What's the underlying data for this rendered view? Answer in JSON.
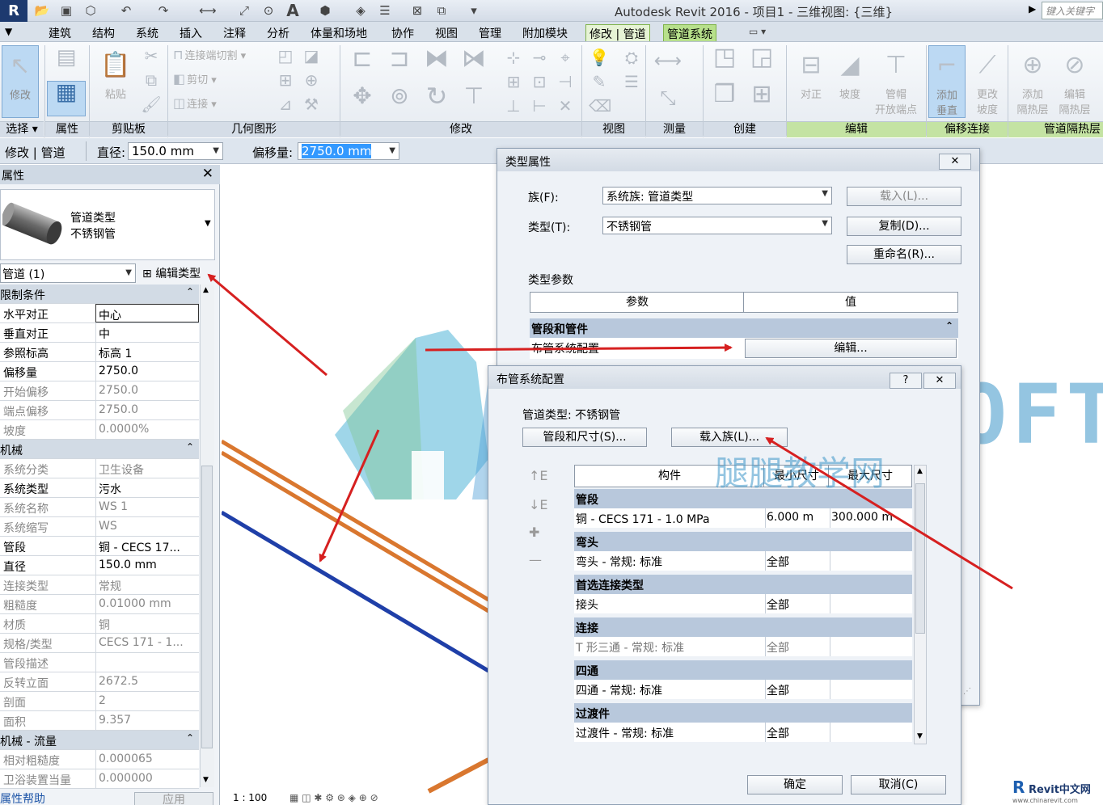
{
  "titlebar": {
    "app_letter": "R",
    "title": "Autodesk Revit 2016 -    项目1 - 三维视图: {三维}",
    "search_placeholder": "键入关键字"
  },
  "tabs": [
    "建筑",
    "结构",
    "系统",
    "插入",
    "注释",
    "分析",
    "体量和场地",
    "协作",
    "视图",
    "管理",
    "附加模块",
    "修改 | 管道",
    "管道系统"
  ],
  "ribbon": {
    "groups": [
      "选择",
      "属性",
      "剪贴板",
      "几何图形",
      "修改",
      "视图",
      "测量",
      "创建",
      "编辑",
      "偏移连接",
      "管道隔热层"
    ],
    "buttons": {
      "modify": "修改",
      "paste": "粘贴",
      "join_cutback": "连接端切割",
      "cut": "剪切",
      "join": "连接",
      "justify": "对正",
      "slope": "坡度",
      "pipe_cap_1": "管帽",
      "pipe_cap_2": "开放端点",
      "add_vertical_1": "添加",
      "add_vertical_2": "垂直",
      "change_slope_1": "更改",
      "change_slope_2": "坡度",
      "add_insulation_1": "添加",
      "add_insulation_2": "隔热层",
      "edit_insulation_1": "编辑",
      "edit_insulation_2": "隔热层"
    }
  },
  "options_bar": {
    "context": "修改 | 管道",
    "diameter_label": "直径:",
    "diameter_value": "150.0 mm",
    "offset_label": "偏移量:",
    "offset_value": "2750.0 mm"
  },
  "properties": {
    "title": "属性",
    "type_line1": "管道类型",
    "type_line2": "不锈钢管",
    "filter": "管道 (1)",
    "edit_type": "编辑类型",
    "help": "属性帮助",
    "apply": "应用",
    "rows": [
      {
        "name": "限制条件",
        "value": "",
        "kind": "hdr"
      },
      {
        "name": "水平对正",
        "value": "中心",
        "kind": "focus"
      },
      {
        "name": "垂直对正",
        "value": "中",
        "kind": ""
      },
      {
        "name": "参照标高",
        "value": "标高 1",
        "kind": ""
      },
      {
        "name": "偏移量",
        "value": "2750.0",
        "kind": ""
      },
      {
        "name": "开始偏移",
        "value": "2750.0",
        "kind": "dis"
      },
      {
        "name": "端点偏移",
        "value": "2750.0",
        "kind": "dis"
      },
      {
        "name": "坡度",
        "value": "0.0000%",
        "kind": "dis"
      },
      {
        "name": "机械",
        "value": "",
        "kind": "hdr"
      },
      {
        "name": "系统分类",
        "value": "卫生设备",
        "kind": "dis"
      },
      {
        "name": "系统类型",
        "value": "污水",
        "kind": ""
      },
      {
        "name": "系统名称",
        "value": "WS 1",
        "kind": "dis"
      },
      {
        "name": "系统缩写",
        "value": "WS",
        "kind": "dis"
      },
      {
        "name": "管段",
        "value": "铜 - CECS 17...",
        "kind": ""
      },
      {
        "name": "直径",
        "value": "150.0 mm",
        "kind": ""
      },
      {
        "name": "连接类型",
        "value": "常规",
        "kind": "dis"
      },
      {
        "name": "粗糙度",
        "value": "0.01000 mm",
        "kind": "dis"
      },
      {
        "name": "材质",
        "value": "铜",
        "kind": "dis"
      },
      {
        "name": "规格/类型",
        "value": "CECS 171 - 1...",
        "kind": "dis"
      },
      {
        "name": "管段描述",
        "value": "",
        "kind": "dis"
      },
      {
        "name": "反转立面",
        "value": "2672.5",
        "kind": "dis"
      },
      {
        "name": "剖面",
        "value": "2",
        "kind": "dis"
      },
      {
        "name": "面积",
        "value": "9.357",
        "kind": "dis"
      },
      {
        "name": "机械 - 流量",
        "value": "",
        "kind": "hdr"
      },
      {
        "name": "相对粗糙度",
        "value": "0.000065",
        "kind": "dis"
      },
      {
        "name": "卫浴装置当量",
        "value": "0.000000",
        "kind": "dis"
      }
    ]
  },
  "viewbar": {
    "scale": "1 : 100"
  },
  "type_dialog": {
    "title": "类型属性",
    "family_label": "族(F):",
    "family_value": "系统族: 管道类型",
    "type_label": "类型(T):",
    "type_value": "不锈钢管",
    "load_btn": "载入(L)...",
    "duplicate_btn": "复制(D)...",
    "rename_btn": "重命名(R)...",
    "params_label": "类型参数",
    "col_param": "参数",
    "col_value": "值",
    "group": "管段和管件",
    "row_name": "布管系统配置",
    "row_btn": "编辑..."
  },
  "routing_dialog": {
    "title": "布管系统配置",
    "help": "?",
    "pipe_type_label": "管道类型:",
    "pipe_type_value": "不锈钢管",
    "segments_btn": "管段和尺寸(S)...",
    "load_family_btn": "载入族(L)...",
    "col_component": "构件",
    "col_min": "最小尺寸",
    "col_max": "最大尺寸",
    "groups": [
      {
        "name": "管段",
        "item": "铜 - CECS 171 - 1.0 MPa",
        "min": "6.000 m",
        "max": "300.000 m",
        "dis": false
      },
      {
        "name": "弯头",
        "item": "弯头 - 常规: 标准",
        "min": "全部",
        "max": "",
        "dis": false
      },
      {
        "name": "首选连接类型",
        "item": "接头",
        "min": "全部",
        "max": "",
        "dis": false
      },
      {
        "name": "连接",
        "item": "T 形三通 - 常规: 标准",
        "min": "全部",
        "max": "",
        "dis": true
      },
      {
        "name": "四通",
        "item": "四通 - 常规: 标准",
        "min": "全部",
        "max": "",
        "dis": false
      },
      {
        "name": "过渡件",
        "item": "过渡件 - 常规: 标准",
        "min": "全部",
        "max": "",
        "dis": false
      }
    ],
    "ok_btn": "确定",
    "cancel_btn": "取消(C)"
  },
  "watermark": {
    "text": "TUITUISOFT",
    "sub": "腿腿教学网"
  },
  "corner_logo": {
    "name": "Revit中文网",
    "url": "www.chinarevit.com"
  },
  "colors": {
    "arrow": "#d62020",
    "pipe_orange": "#d9772f",
    "pipe_blue": "#1f3fa8",
    "context_tab": "#b7e08b"
  }
}
